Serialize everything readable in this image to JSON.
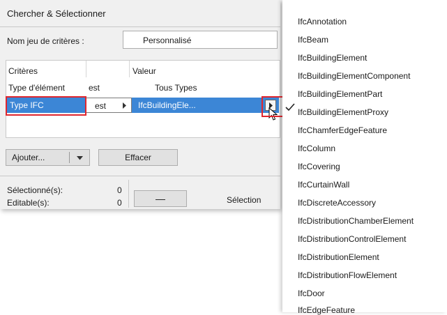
{
  "dialog": {
    "title": "Chercher & Sélectionner",
    "criteria_set_label": "Nom jeu de critères :",
    "criteria_set_value": "Personnalisé",
    "columns": {
      "criteria": "Critères",
      "value": "Valeur"
    },
    "row1": {
      "criterion": "Type d'élément",
      "operator": "est",
      "value": "Tous Types"
    },
    "row2": {
      "criterion": "Type IFC",
      "operator": "est",
      "value": "IfcBuildingEle..."
    },
    "add_button": "Ajouter...",
    "clear_button": "Effacer",
    "selected_label": "Sélectionné(s):",
    "selected_count": "0",
    "editable_label": "Editable(s):",
    "editable_count": "0",
    "minus_button": "—",
    "selection_label": "Sélection"
  },
  "menu": {
    "checked_item": "IfcBuildingElementProxy",
    "items": [
      "IfcAnnotation",
      "IfcBeam",
      "IfcBuildingElement",
      "IfcBuildingElementComponent",
      "IfcBuildingElementPart",
      "IfcBuildingElementProxy",
      "IfcChamferEdgeFeature",
      "IfcColumn",
      "IfcCovering",
      "IfcCurtainWall",
      "IfcDiscreteAccessory",
      "IfcDistributionChamberElement",
      "IfcDistributionControlElement",
      "IfcDistributionElement",
      "IfcDistributionFlowElement",
      "IfcDoor",
      "IfcEdgeFeature"
    ]
  }
}
